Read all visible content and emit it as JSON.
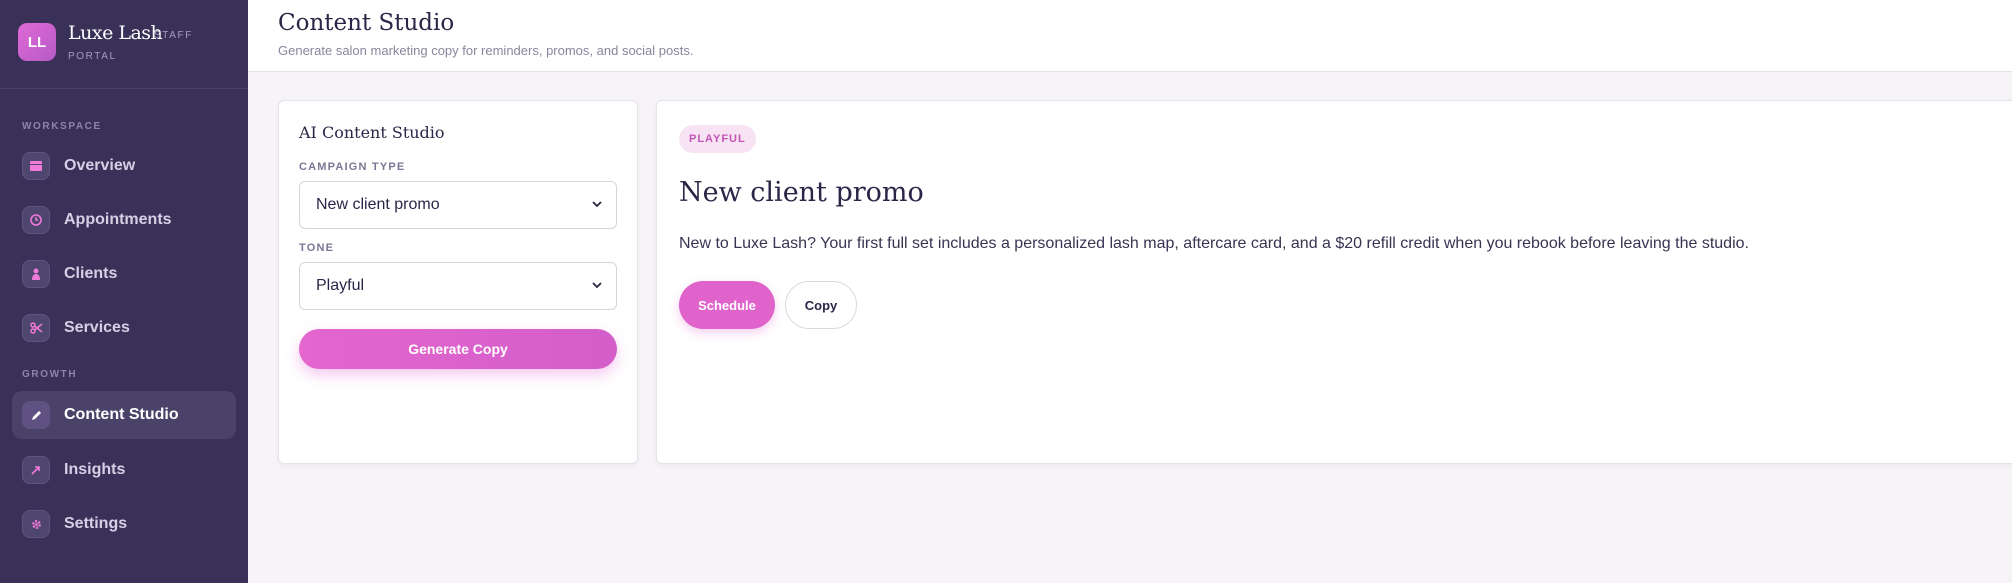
{
  "brand": {
    "logo_initials": "LL",
    "name": "Luxe Lash",
    "sub_line1": "STAFF",
    "sub_line2": "PORTAL"
  },
  "sidebar": {
    "sections": [
      {
        "label": "WORKSPACE"
      },
      {
        "label": "GROWTH"
      }
    ],
    "items": [
      {
        "label": "Overview",
        "icon": "grid-icon",
        "active": false
      },
      {
        "label": "Appointments",
        "icon": "clock-icon",
        "active": false
      },
      {
        "label": "Clients",
        "icon": "user-icon",
        "active": false
      },
      {
        "label": "Services",
        "icon": "scissors-icon",
        "active": false
      },
      {
        "label": "Content Studio",
        "icon": "pen-icon",
        "active": true
      },
      {
        "label": "Insights",
        "icon": "trend-arrow-icon",
        "active": false
      },
      {
        "label": "Settings",
        "icon": "gear-icon",
        "active": false
      }
    ]
  },
  "header": {
    "title": "Content Studio",
    "subtitle": "Generate salon marketing copy for reminders, promos, and social posts."
  },
  "form": {
    "title": "AI Content Studio",
    "campaign_type_label": "CAMPAIGN TYPE",
    "campaign_type_value": "New client promo",
    "tone_label": "TONE",
    "tone_value": "Playful",
    "generate_label": "Generate Copy"
  },
  "result": {
    "badge": "PLAYFUL",
    "title": "New client promo",
    "body": "New to Luxe Lash? Your first full set includes a personalized lash map, aftercare card, and a $20 refill credit when you rebook before leaving the studio.",
    "schedule_label": "Schedule",
    "copy_label": "Copy"
  },
  "colors": {
    "sidebar_bg": "#3a3158",
    "accent": "#df63cb",
    "badge_bg": "#f7e3f3",
    "page_bg": "#f6f4f6"
  }
}
